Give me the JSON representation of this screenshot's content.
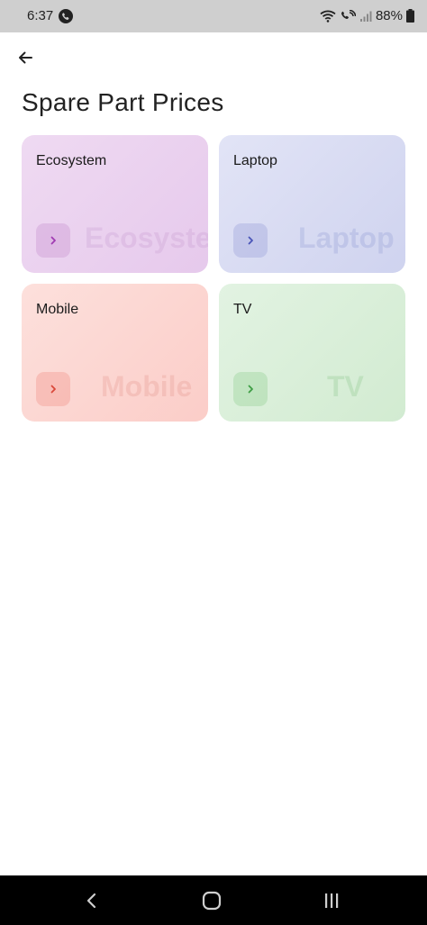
{
  "status_bar": {
    "time": "6:37",
    "battery": "88%",
    "icons": [
      "phone-call-icon",
      "wifi-icon",
      "wifi-calling-icon",
      "signal-icon",
      "battery-icon"
    ]
  },
  "header": {
    "back_icon": "arrow-left-icon",
    "title": "Spare Part Prices"
  },
  "categories": [
    {
      "label": "Ecosystem",
      "watermark": "Ecosystem",
      "accent": "#a03bb2"
    },
    {
      "label": "Laptop",
      "watermark": "Laptop",
      "accent": "#4a55b8"
    },
    {
      "label": "Mobile",
      "watermark": "Mobile",
      "accent": "#d9483a"
    },
    {
      "label": "TV",
      "watermark": "TV",
      "accent": "#3e9e44"
    }
  ],
  "nav_bar": {
    "icons": [
      "back-nav-icon",
      "home-nav-icon",
      "recent-apps-icon"
    ]
  }
}
